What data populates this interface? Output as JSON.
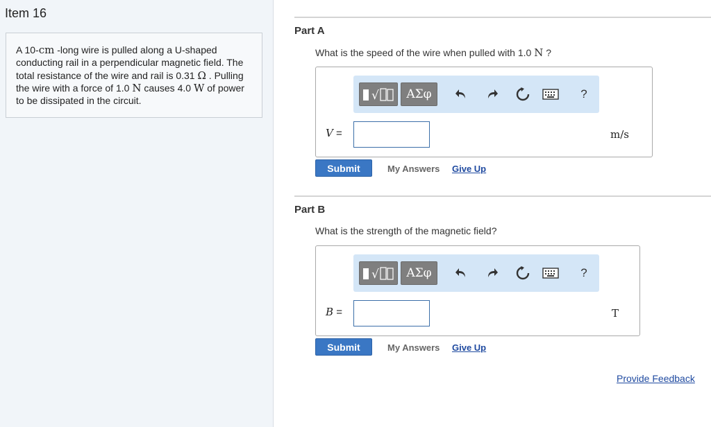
{
  "item": {
    "title": "Item 16"
  },
  "problem": {
    "t1": "A 10-",
    "u1": "cm",
    "t2": " -long wire is pulled along a U-shaped conducting rail in a perpendicular magnetic field. The total resistance of the wire and rail is 0.31 ",
    "u2": "Ω",
    "t3": " . Pulling the wire with a force of 1.0 ",
    "u3": "N",
    "t4": " causes 4.0 ",
    "u4": "W",
    "t5": " of power to be dissipated in the circuit."
  },
  "toolbar": {
    "templates_glyph": "▮√▯",
    "greek_label": "ΑΣφ",
    "undo_icon": "undo-icon",
    "redo_icon": "redo-icon",
    "reset_icon": "reset-icon",
    "keyboard_icon": "keyboard-icon",
    "help_label": "?"
  },
  "partA": {
    "title": "Part A",
    "question_text": "What is the speed of the wire when pulled with 1.0 ",
    "question_unit": "N",
    "question_end": " ?",
    "var": "V",
    "eq": " =",
    "value": "",
    "unit": "m/s",
    "submit": "Submit",
    "my_answers": "My Answers",
    "give_up": "Give Up"
  },
  "partB": {
    "title": "Part B",
    "question_text": "What is the strength of the magnetic field?",
    "var": "B",
    "eq": " =",
    "value": "",
    "unit": "T",
    "submit": "Submit",
    "my_answers": "My Answers",
    "give_up": "Give Up"
  },
  "footer": {
    "feedback": "Provide Feedback"
  },
  "colors": {
    "submit": "#3a77c4",
    "toolbar_bg": "#d4e6f7",
    "link": "#1f4aa0",
    "left_bg": "#f1f5f9"
  }
}
